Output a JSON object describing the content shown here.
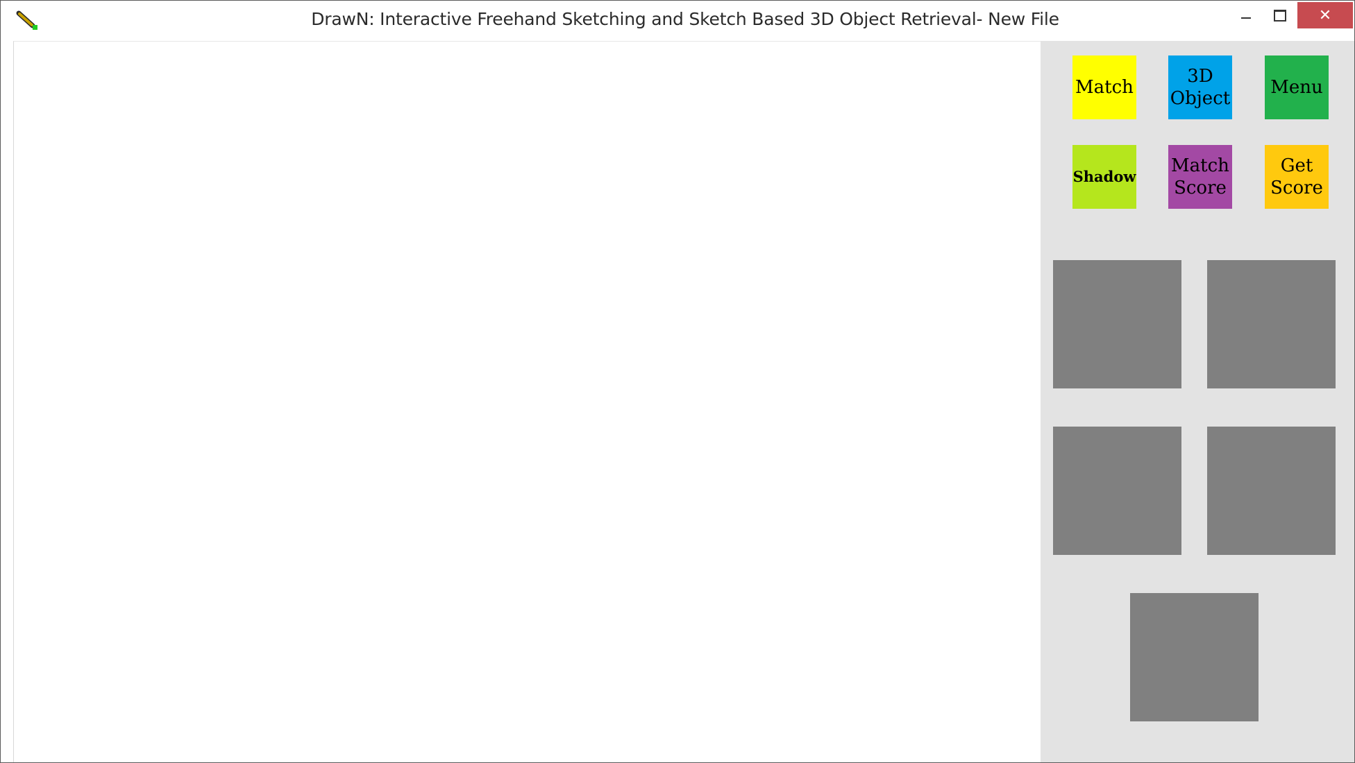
{
  "window": {
    "title": "DrawN: Interactive Freehand Sketching and Sketch Based 3D Object Retrieval- New File",
    "app_icon": "pencil-icon",
    "controls": {
      "minimize": "minimize-icon",
      "maximize": "maximize-icon",
      "close": "close-icon",
      "close_glyph": "✕"
    }
  },
  "toolbar": {
    "buttons": [
      {
        "label": "Match",
        "color": "#ffff00"
      },
      {
        "label": "3D\nObject",
        "color": "#00a2e8"
      },
      {
        "label": "Menu",
        "color": "#22b14c"
      },
      {
        "label": "Shadow",
        "color": "#b5e61d"
      },
      {
        "label": "Match\nScore",
        "color": "#a349a4"
      },
      {
        "label": "Get\nScore",
        "color": "#ffc90e"
      }
    ]
  },
  "results": {
    "thumbnail_color": "#808080",
    "thumbnails": [
      {
        "slot": 1
      },
      {
        "slot": 2
      },
      {
        "slot": 3
      },
      {
        "slot": 4
      },
      {
        "slot": 5
      }
    ]
  }
}
